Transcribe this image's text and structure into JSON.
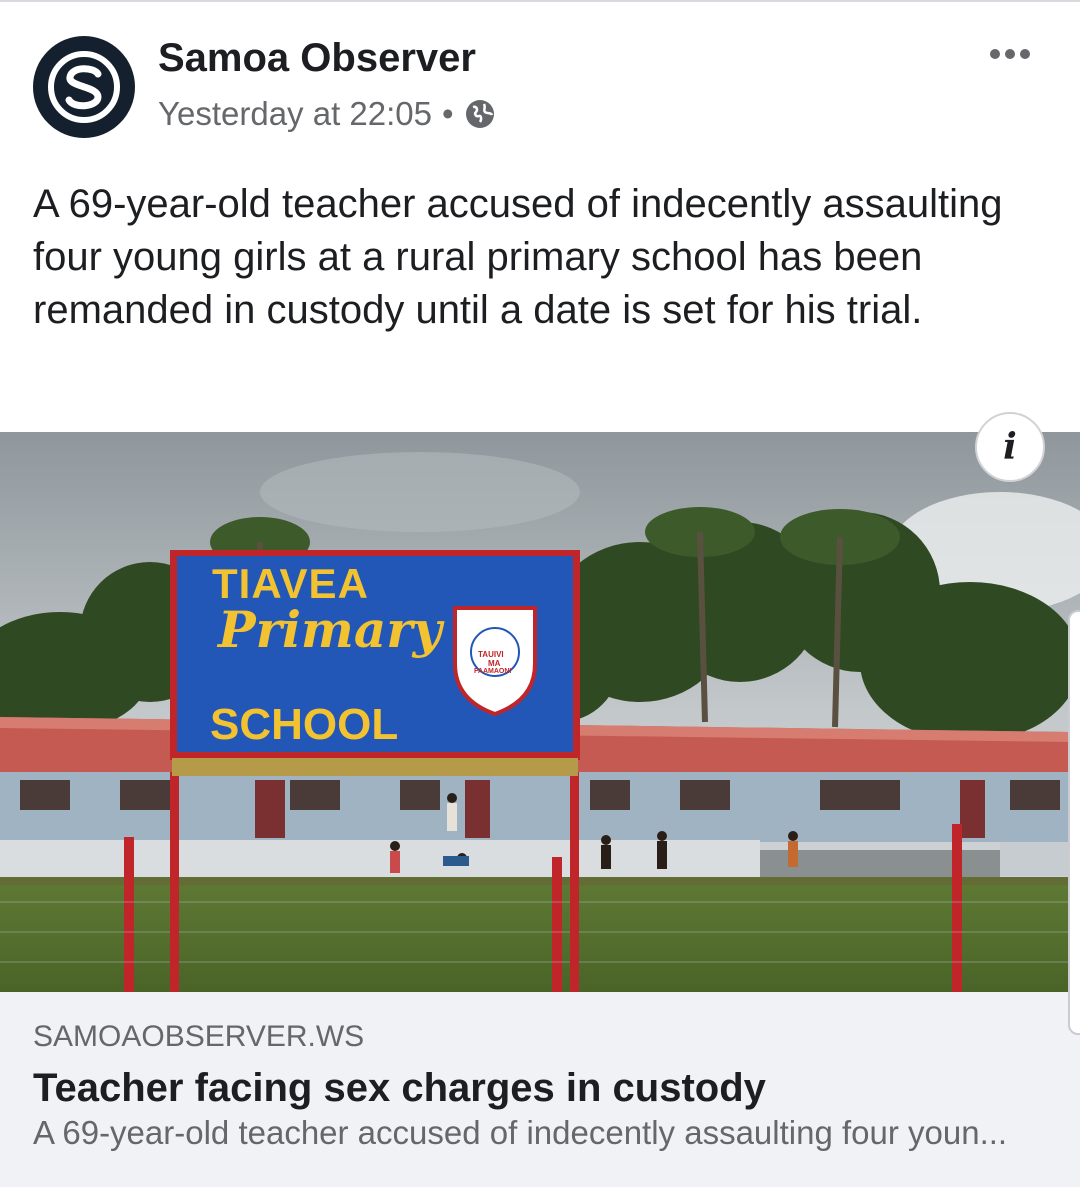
{
  "post": {
    "page_name": "Samoa Observer",
    "timestamp": "Yesterday at 22:05",
    "separator": "•",
    "privacy_icon": "globe-icon",
    "more_icon": "more-options-icon",
    "body": "A 69-year-old teacher accused of indecently assaulting four young girls at a rural primary school has been remanded in custody until a date is set for his trial."
  },
  "photo": {
    "sign_line1": "TIAVEA",
    "sign_line2": "Primary",
    "sign_line3": "SCHOOL",
    "crest_text1": "TAUIVI",
    "crest_text2": "MA",
    "crest_text3": "FAAMAONI",
    "info_label": "i"
  },
  "link_preview": {
    "domain": "SAMOAOBSERVER.WS",
    "title": "Teacher facing sex charges in custody",
    "description": "A 69-year-old teacher accused of indecently assaulting four youn..."
  },
  "colors": {
    "text_primary": "#1c1e21",
    "text_secondary": "#65676b",
    "preview_bg": "#f0f2f5",
    "avatar_bg": "#14202e",
    "sign_blue": "#2257b8",
    "sign_yellow": "#f2c230"
  }
}
